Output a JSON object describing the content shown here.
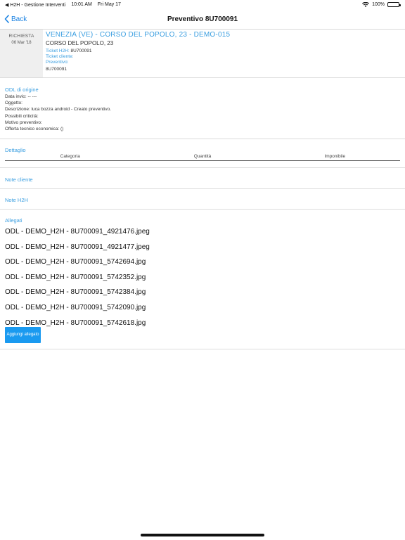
{
  "status_bar": {
    "back_app": "◀ H2H - Gestione Interventi",
    "time": "10:01 AM",
    "date": "Fri May 17",
    "battery": "100%"
  },
  "nav": {
    "back_label": "Back",
    "title": "Preventivo 8U700091"
  },
  "request": {
    "label": "RICHIESTA",
    "date": "06 Mar '18",
    "title": "VENEZIA (VE) - CORSO DEL POPOLO, 23 - DEMO-015",
    "address": "CORSO DEL POPOLO, 23",
    "ticket_h2h_label": "Ticket H2H:",
    "ticket_h2h_value": "8U700091",
    "ticket_cliente_label": "Ticket cliente:",
    "preventivo_label": "Preventivo:",
    "preventivo_value": "8U700091"
  },
  "odl": {
    "title": "ODL di origine",
    "data_invio": "Data invio:  -- ---",
    "oggetto": "Oggetto:",
    "descrizione": "Descrizione:  luca bozza android - Creato preventivo.",
    "criticita": "Possibili criticità:",
    "motivo": "Motivo preventivo:",
    "offerta": "Offerta tecnico economica:  ()"
  },
  "dettaglio": {
    "title": "Dettaglio",
    "columns": [
      "Categoria",
      "Quantità",
      "Imponibile"
    ]
  },
  "note_cliente": {
    "title": "Note cliente"
  },
  "note_h2h": {
    "title": "Note H2H"
  },
  "allegati": {
    "title": "Allegati",
    "files": [
      "ODL - DEMO_H2H - 8U700091_4921476.jpeg",
      "ODL - DEMO_H2H - 8U700091_4921477.jpeg",
      "ODL - DEMO_H2H - 8U700091_5742694.jpg",
      "ODL - DEMO_H2H - 8U700091_5742352.jpg",
      "ODL - DEMO_H2H - 8U700091_5742384.jpg",
      "ODL - DEMO_H2H - 8U700091_5742090.jpg",
      "ODL - DEMO_H2H - 8U700091_5742618.jpg"
    ],
    "add_button": "Aggiungi allegato"
  },
  "colors": {
    "accent": "#1a82e2",
    "label_blue": "#3a9ee0",
    "button_blue": "#1a9af0"
  }
}
